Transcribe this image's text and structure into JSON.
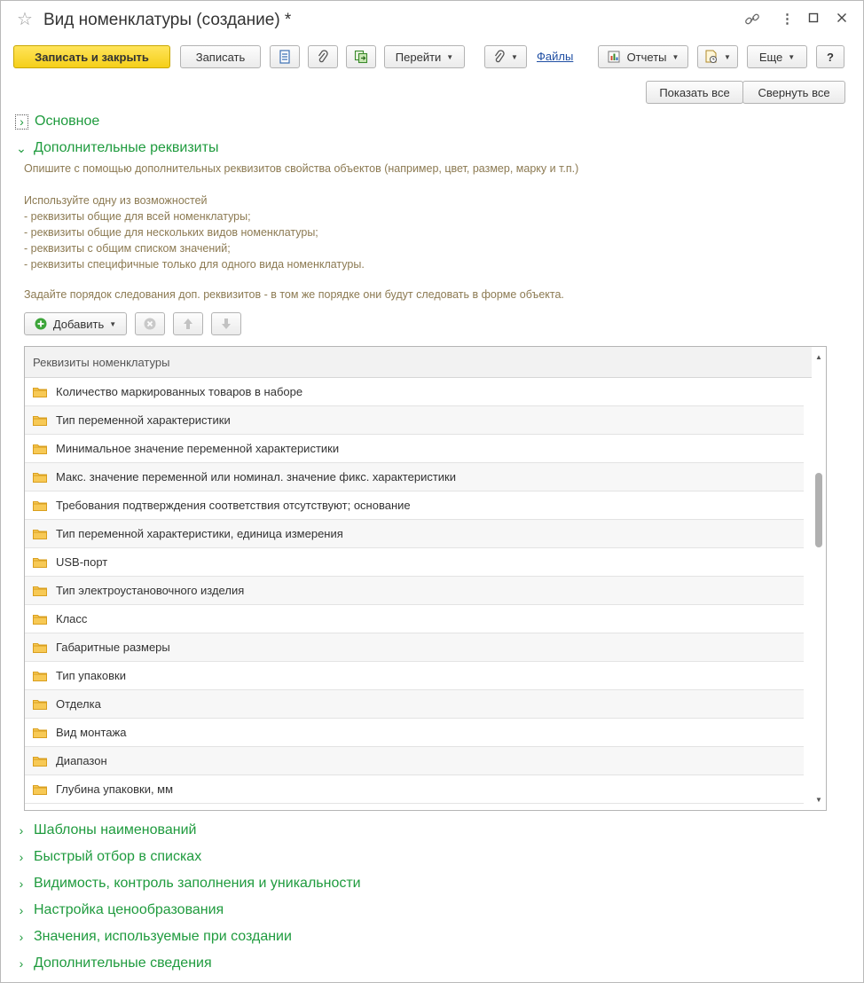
{
  "window": {
    "title": "Вид номенклатуры (создание) *"
  },
  "toolbar": {
    "save_close": "Записать и закрыть",
    "save": "Записать",
    "goto": "Перейти",
    "files": "Файлы",
    "reports": "Отчеты",
    "more": "Еще",
    "help": "?"
  },
  "view_buttons": {
    "show_all": "Показать все",
    "collapse_all": "Свернуть все"
  },
  "sections": {
    "main": "Основное",
    "extra": "Дополнительные реквизиты"
  },
  "description": {
    "line1": "Опишите с помощью дополнительных реквизитов свойства объектов (например, цвет, размер, марку и т.п.)",
    "line2": "Используйте одну из возможностей",
    "line3": "- реквизиты общие для всей номенклатуры;",
    "line4": "- реквизиты общие для нескольких видов номенклатуры;",
    "line5": "- реквизиты с общим списком значений;",
    "line6": "- реквизиты специфичные только для одного вида номенклатуры.",
    "line7": "Задайте порядок следования доп. реквизитов - в том же порядке они будут следовать в форме объекта."
  },
  "list_toolbar": {
    "add": "Добавить"
  },
  "grid": {
    "header": "Реквизиты номенклатуры",
    "rows": [
      "Количество маркированных товаров в наборе",
      "Тип переменной характеристики",
      "Минимальное значение переменной характеристики",
      "Макс. значение переменной или номинал. значение фикс. характеристики",
      "Требования подтверждения соответствия отсутствуют; основание",
      "Тип переменной характеристики, единица измерения",
      "USB-порт",
      "Тип электроустановочного изделия",
      "Класс",
      "Габаритные размеры",
      "Тип упаковки",
      "Отделка",
      "Вид монтажа",
      "Диапазон",
      "Глубина упаковки, мм"
    ]
  },
  "collapsed_sections": [
    "Шаблоны наименований",
    "Быстрый отбор в списках",
    "Видимость, контроль заполнения и уникальности",
    "Настройка ценообразования",
    "Значения, используемые при создании",
    "Дополнительные сведения"
  ],
  "colors": {
    "accent_green": "#1f9b3e",
    "primary_button": "#f5cf19",
    "link": "#1f4ea3",
    "hint_text": "#8c7a52"
  }
}
